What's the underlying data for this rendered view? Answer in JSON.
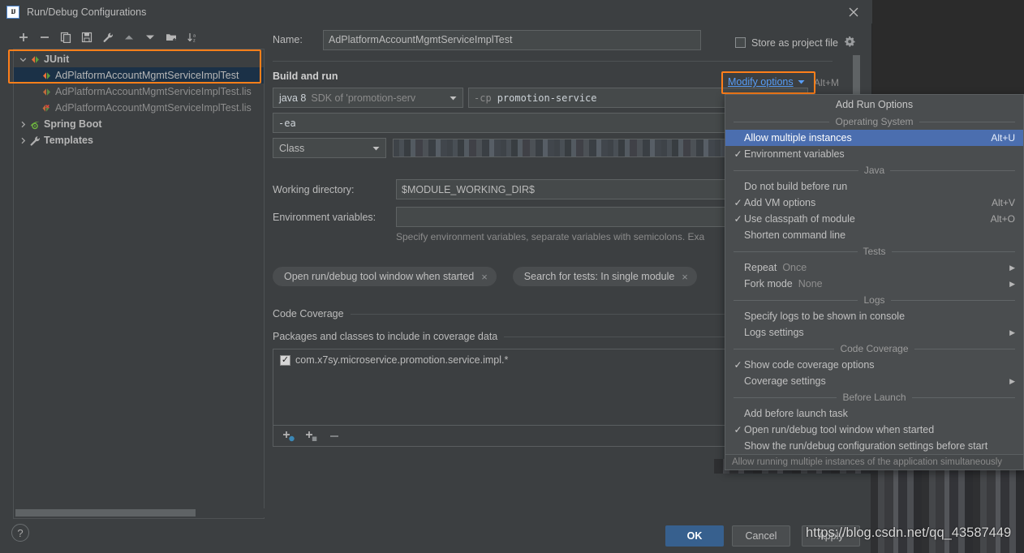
{
  "window": {
    "title": "Run/Debug Configurations",
    "logo_text": "IJ",
    "close_icon": "close-icon"
  },
  "tree_toolbar": {
    "buttons": [
      {
        "name": "add-configuration-button",
        "icon": "plus-icon"
      },
      {
        "name": "remove-configuration-button",
        "icon": "minus-icon"
      },
      {
        "name": "copy-configuration-button",
        "icon": "copy-icon"
      },
      {
        "name": "save-configuration-button",
        "icon": "save-icon"
      },
      {
        "name": "edit-templates-button",
        "icon": "wrench-icon"
      },
      {
        "name": "move-up-button",
        "icon": "triangle-up-icon"
      },
      {
        "name": "move-down-button",
        "icon": "triangle-down-icon"
      },
      {
        "name": "new-folder-button",
        "icon": "folder-plus-icon"
      },
      {
        "name": "sort-alphabetically-button",
        "icon": "sort-az-icon"
      }
    ]
  },
  "tree": {
    "items": [
      {
        "label": "JUnit",
        "indent": 0,
        "expanded": true,
        "icon": "junit-icon",
        "bold": true,
        "selected": false,
        "dim": false
      },
      {
        "label": "AdPlatformAccountMgmtServiceImplTest",
        "indent": 1,
        "expanded": null,
        "icon": "junit-icon",
        "bold": false,
        "selected": true,
        "dim": false
      },
      {
        "label": "AdPlatformAccountMgmtServiceImplTest.lis",
        "indent": 1,
        "expanded": null,
        "icon": "junit-icon",
        "bold": false,
        "selected": false,
        "dim": true
      },
      {
        "label": "AdPlatformAccountMgmtServiceImplTest.lis",
        "indent": 1,
        "expanded": null,
        "icon": "junit-error-icon",
        "bold": false,
        "selected": false,
        "dim": true
      },
      {
        "label": "Spring Boot",
        "indent": 0,
        "expanded": false,
        "icon": "spring-icon",
        "bold": true,
        "selected": false,
        "dim": false
      },
      {
        "label": "Templates",
        "indent": 0,
        "expanded": false,
        "icon": "wrench-icon",
        "bold": true,
        "selected": false,
        "dim": false
      }
    ]
  },
  "help": {
    "label": "?"
  },
  "form": {
    "name_label": "Name:",
    "name_value": "AdPlatformAccountMgmtServiceImplTest",
    "store_as_project_file_label": "Store as project file",
    "store_as_project_file_checked": false,
    "gear_icon": "gear-icon",
    "build_and_run_label": "Build and run",
    "jre_value_bold": "java 8",
    "jre_value_dim": "SDK of 'promotion-serv",
    "classpath_prefix": "-cp",
    "classpath_value": "promotion-service",
    "vm_options_value": "-ea",
    "kind_value": "Class",
    "class_value_masked": "",
    "working_directory_label": "Working directory:",
    "working_directory_value": "$MODULE_WORKING_DIR$",
    "environment_variables_label": "Environment variables:",
    "environment_variables_value": "",
    "environment_hint": "Specify environment variables, separate variables with semicolons. Exa",
    "chips": [
      {
        "label": "Open run/debug tool window when started",
        "close": "×"
      },
      {
        "label": "Search for tests: In single module",
        "close": "×"
      }
    ],
    "code_coverage_label": "Code Coverage",
    "packages_label": "Packages and classes to include in coverage data",
    "coverage_items": [
      {
        "label": "com.x7sy.microservice.promotion.service.impl.*",
        "checked": true
      }
    ],
    "coverage_toolbar": [
      {
        "name": "add-package-button",
        "icon": "plus-package-icon"
      },
      {
        "name": "add-class-button",
        "icon": "plus-class-icon"
      },
      {
        "name": "remove-coverage-entry-button",
        "icon": "minus-icon"
      }
    ]
  },
  "modify_options": {
    "link_label": "Modify options",
    "chevron": "chevron-down-icon",
    "shortcut": "Alt+M"
  },
  "menu": {
    "title": "Add Run Options",
    "groups": [
      {
        "header": "Operating System",
        "items": [
          {
            "label": "Allow multiple instances",
            "checked": false,
            "shortcut": "Alt+U",
            "selected": true,
            "submenu": false,
            "value": ""
          },
          {
            "label": "Environment variables",
            "checked": true,
            "shortcut": "",
            "selected": false,
            "submenu": false,
            "value": ""
          }
        ]
      },
      {
        "header": "Java",
        "items": [
          {
            "label": "Do not build before run",
            "checked": false,
            "shortcut": "",
            "selected": false,
            "submenu": false,
            "value": ""
          },
          {
            "label": "Add VM options",
            "checked": true,
            "shortcut": "Alt+V",
            "selected": false,
            "submenu": false,
            "value": ""
          },
          {
            "label": "Use classpath of module",
            "checked": true,
            "shortcut": "Alt+O",
            "selected": false,
            "submenu": false,
            "value": ""
          },
          {
            "label": "Shorten command line",
            "checked": false,
            "shortcut": "",
            "selected": false,
            "submenu": false,
            "value": ""
          }
        ]
      },
      {
        "header": "Tests",
        "items": [
          {
            "label": "Repeat",
            "checked": false,
            "shortcut": "",
            "selected": false,
            "submenu": true,
            "value": "Once"
          },
          {
            "label": "Fork mode",
            "checked": false,
            "shortcut": "",
            "selected": false,
            "submenu": true,
            "value": "None"
          }
        ]
      },
      {
        "header": "Logs",
        "items": [
          {
            "label": "Specify logs to be shown in console",
            "checked": false,
            "shortcut": "",
            "selected": false,
            "submenu": false,
            "value": ""
          },
          {
            "label": "Logs settings",
            "checked": false,
            "shortcut": "",
            "selected": false,
            "submenu": true,
            "value": ""
          }
        ]
      },
      {
        "header": "Code Coverage",
        "items": [
          {
            "label": "Show code coverage options",
            "checked": true,
            "shortcut": "",
            "selected": false,
            "submenu": false,
            "value": ""
          },
          {
            "label": "Coverage settings",
            "checked": false,
            "shortcut": "",
            "selected": false,
            "submenu": true,
            "value": ""
          }
        ]
      },
      {
        "header": "Before Launch",
        "items": [
          {
            "label": "Add before launch task",
            "checked": false,
            "shortcut": "",
            "selected": false,
            "submenu": false,
            "value": ""
          },
          {
            "label": "Open run/debug tool window when started",
            "checked": true,
            "shortcut": "",
            "selected": false,
            "submenu": false,
            "value": ""
          },
          {
            "label": "Show the run/debug configuration settings before start",
            "checked": false,
            "shortcut": "",
            "selected": false,
            "submenu": false,
            "value": ""
          }
        ]
      }
    ],
    "status_hint": "Allow running multiple instances of the application simultaneously"
  },
  "buttons": {
    "ok": "OK",
    "cancel": "Cancel",
    "apply": "Apply"
  },
  "watermark": {
    "text": "https://blog.csdn.net/qq_43587449"
  },
  "colors": {
    "accent_highlight": "#ff7f1a",
    "menu_selection": "#4b6eaf",
    "link": "#589df6",
    "primary_button": "#37608e",
    "dialog_bg": "#3c3f41",
    "tree_selection": "#1b3147"
  }
}
